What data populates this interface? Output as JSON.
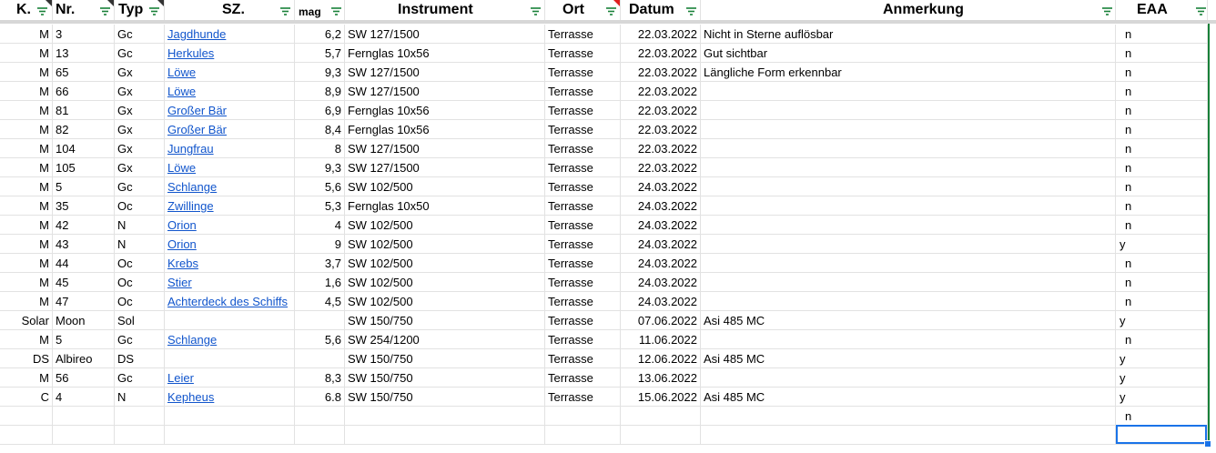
{
  "headers": [
    {
      "label": "K."
    },
    {
      "label": "Nr."
    },
    {
      "label": "Typ"
    },
    {
      "label": "SZ."
    },
    {
      "label": "mag"
    },
    {
      "label": "Instrument"
    },
    {
      "label": "Ort"
    },
    {
      "label": "Datum"
    },
    {
      "label": "Anmerkung"
    },
    {
      "label": "EAA"
    }
  ],
  "rows": [
    {
      "k": "M",
      "nr": "3",
      "typ": "Gc",
      "sz": "Jagdhunde",
      "mag": "6,2",
      "instrument": "SW 127/1500",
      "ort": "Terrasse",
      "datum": "22.03.2022",
      "anmerkung": "Nicht in Sterne auflösbar",
      "eaa": "n"
    },
    {
      "k": "M",
      "nr": "13",
      "typ": "Gc",
      "sz": "Herkules",
      "mag": "5,7",
      "instrument": "Fernglas 10x56",
      "ort": "Terrasse",
      "datum": "22.03.2022",
      "anmerkung": "Gut sichtbar",
      "eaa": "n"
    },
    {
      "k": "M",
      "nr": "65",
      "typ": "Gx",
      "sz": "Löwe",
      "mag": "9,3",
      "instrument": "SW 127/1500",
      "ort": "Terrasse",
      "datum": "22.03.2022",
      "anmerkung": "Längliche Form erkennbar",
      "eaa": "n"
    },
    {
      "k": "M",
      "nr": "66",
      "typ": "Gx",
      "sz": "Löwe",
      "mag": "8,9",
      "instrument": "SW 127/1500",
      "ort": "Terrasse",
      "datum": "22.03.2022",
      "anmerkung": "",
      "eaa": "n"
    },
    {
      "k": "M",
      "nr": "81",
      "typ": "Gx",
      "sz": "Großer Bär",
      "mag": "6,9",
      "instrument": "Fernglas 10x56",
      "ort": "Terrasse",
      "datum": "22.03.2022",
      "anmerkung": "",
      "eaa": "n"
    },
    {
      "k": "M",
      "nr": "82",
      "typ": "Gx",
      "sz": "Großer Bär",
      "mag": "8,4",
      "instrument": "Fernglas 10x56",
      "ort": "Terrasse",
      "datum": "22.03.2022",
      "anmerkung": "",
      "eaa": "n"
    },
    {
      "k": "M",
      "nr": "104",
      "typ": "Gx",
      "sz": "Jungfrau",
      "mag": "8",
      "instrument": "SW 127/1500",
      "ort": "Terrasse",
      "datum": "22.03.2022",
      "anmerkung": "",
      "eaa": "n"
    },
    {
      "k": "M",
      "nr": "105",
      "typ": "Gx",
      "sz": "Löwe",
      "mag": "9,3",
      "instrument": "SW 127/1500",
      "ort": "Terrasse",
      "datum": "22.03.2022",
      "anmerkung": "",
      "eaa": "n"
    },
    {
      "k": "M",
      "nr": "5",
      "typ": "Gc",
      "sz": "Schlange",
      "mag": "5,6",
      "instrument": "SW 102/500",
      "ort": "Terrasse",
      "datum": "24.03.2022",
      "anmerkung": "",
      "eaa": "n"
    },
    {
      "k": "M",
      "nr": "35",
      "typ": "Oc",
      "sz": "Zwillinge",
      "mag": "5,3",
      "instrument": "Fernglas 10x50",
      "ort": "Terrasse",
      "datum": "24.03.2022",
      "anmerkung": "",
      "eaa": "n"
    },
    {
      "k": "M",
      "nr": "42",
      "typ": "N",
      "sz": "Orion",
      "mag": "4",
      "instrument": "SW 102/500",
      "ort": "Terrasse",
      "datum": "24.03.2022",
      "anmerkung": "",
      "eaa": "n"
    },
    {
      "k": "M",
      "nr": "43",
      "typ": "N",
      "sz": "Orion",
      "mag": "9",
      "instrument": "SW 102/500",
      "ort": "Terrasse",
      "datum": "24.03.2022",
      "anmerkung": "",
      "eaa": "y"
    },
    {
      "k": "M",
      "nr": "44",
      "typ": "Oc",
      "sz": "Krebs",
      "mag": "3,7",
      "instrument": "SW 102/500",
      "ort": "Terrasse",
      "datum": "24.03.2022",
      "anmerkung": "",
      "eaa": "n"
    },
    {
      "k": "M",
      "nr": "45",
      "typ": "Oc",
      "sz": "Stier",
      "mag": "1,6",
      "instrument": "SW 102/500",
      "ort": "Terrasse",
      "datum": "24.03.2022",
      "anmerkung": "",
      "eaa": "n"
    },
    {
      "k": "M",
      "nr": "47",
      "typ": "Oc",
      "sz": "Achterdeck des Schiffs",
      "mag": "4,5",
      "instrument": "SW 102/500",
      "ort": "Terrasse",
      "datum": "24.03.2022",
      "anmerkung": "",
      "eaa": "n"
    },
    {
      "k": "Solar",
      "nr": "Moon",
      "typ": "Sol",
      "sz": "",
      "mag": "",
      "instrument": "SW 150/750",
      "ort": "Terrasse",
      "datum": "07.06.2022",
      "anmerkung": "Asi 485 MC",
      "eaa": "y"
    },
    {
      "k": "M",
      "nr": "5",
      "typ": "Gc",
      "sz": "Schlange",
      "mag": "5,6",
      "instrument": "SW 254/1200",
      "ort": "Terrasse",
      "datum": "11.06.2022",
      "anmerkung": "",
      "eaa": "n"
    },
    {
      "k": "DS",
      "nr": "Albireo",
      "typ": "DS",
      "sz": "",
      "mag": "",
      "instrument": "SW 150/750",
      "ort": "Terrasse",
      "datum": "12.06.2022",
      "anmerkung": "Asi 485 MC",
      "eaa": "y"
    },
    {
      "k": "M",
      "nr": "56",
      "typ": "Gc",
      "sz": "Leier",
      "mag": "8,3",
      "instrument": "SW 150/750",
      "ort": "Terrasse",
      "datum": "13.06.2022",
      "anmerkung": "",
      "eaa": "y"
    },
    {
      "k": "C",
      "nr": "4",
      "typ": "N",
      "sz": "Kepheus",
      "mag": "6.8",
      "instrument": "SW 150/750",
      "ort": "Terrasse",
      "datum": "15.06.2022",
      "anmerkung": "Asi 485 MC",
      "eaa": "y"
    },
    {
      "k": "",
      "nr": "",
      "typ": "",
      "sz": "",
      "mag": "",
      "instrument": "",
      "ort": "",
      "datum": "",
      "anmerkung": "",
      "eaa": "n"
    },
    {
      "k": "",
      "nr": "",
      "typ": "",
      "sz": "",
      "mag": "",
      "instrument": "",
      "ort": "",
      "datum": "",
      "anmerkung": "",
      "eaa": ""
    }
  ],
  "colors": {
    "link": "#1155cc",
    "filter_icon": "#188038",
    "grid": "#e2e2e2",
    "selection": "#1a73e8"
  }
}
